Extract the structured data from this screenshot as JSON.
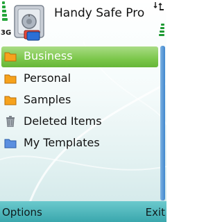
{
  "status_bar": {
    "network_indicator": "3G",
    "top_right_icon": "data-transfer-icon"
  },
  "header": {
    "app_icon": "safe-icon",
    "title": "Handy Safe Pro"
  },
  "list": {
    "items": [
      {
        "label": "Business",
        "icon": "folder-icon",
        "selected": true
      },
      {
        "label": "Personal",
        "icon": "folder-icon",
        "selected": false
      },
      {
        "label": "Samples",
        "icon": "folder-icon",
        "selected": false
      },
      {
        "label": "Deleted Items",
        "icon": "trash-icon",
        "selected": false
      },
      {
        "label": "My Templates",
        "icon": "blue-folder-icon",
        "selected": false
      }
    ]
  },
  "softkeys": {
    "left": "Options",
    "right": "Exit"
  },
  "colors": {
    "selection": "#7cc74b",
    "folder": "#f6a21c",
    "template_folder": "#5a8fe0",
    "softkey_bar": "#4bb7bd"
  }
}
